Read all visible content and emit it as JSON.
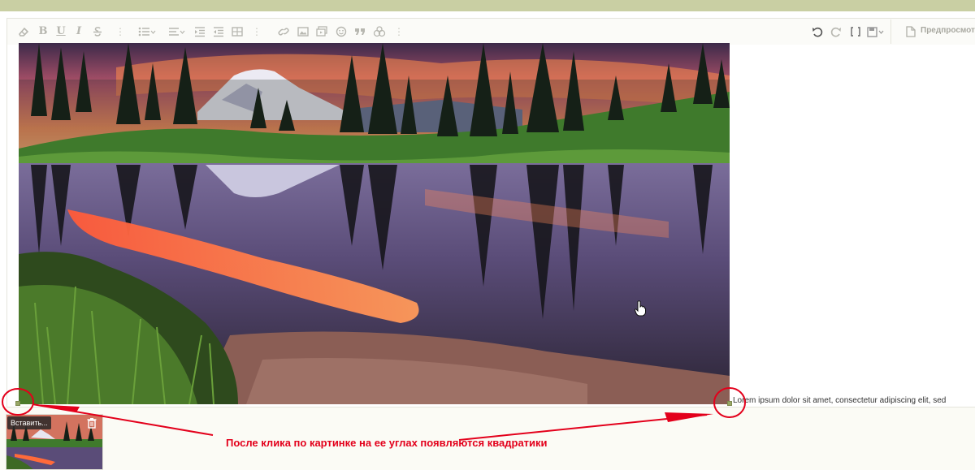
{
  "toolbar": {
    "icons": [
      "eraser-icon",
      "bold-icon",
      "underline-icon",
      "italic-icon",
      "strikethrough-icon",
      "list-icon",
      "align-icon",
      "indent-icon",
      "outdent-icon",
      "table-icon",
      "link-icon",
      "image-icon",
      "media-icon",
      "emoji-icon",
      "quote-icon",
      "spoiler-icon",
      "undo-icon",
      "redo-icon",
      "bbcode-icon",
      "save-draft-icon"
    ],
    "bold_label": "B",
    "underline_label": "U",
    "italic_label": "I",
    "preview_label": "Предпросмотр"
  },
  "editor": {
    "body_text": "Lorem ipsum dolor sit amet, consectetur adipiscing elit, sed"
  },
  "attachments": {
    "insert_label": "Вставить..."
  },
  "annotation": {
    "text": "После клика по картинке на ее углах появляются квадратики",
    "color": "#e3001b"
  },
  "colors": {
    "topbar": "#c9cfa3",
    "handle": "#99a866",
    "toolbar_icon": "#b7b7b0"
  }
}
